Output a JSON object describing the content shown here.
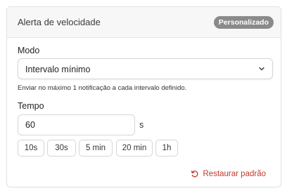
{
  "header": {
    "title": "Alerta de velocidade",
    "badge": "Personalizado"
  },
  "mode": {
    "label": "Modo",
    "selected": "Intervalo mínimo",
    "help_text": "Enviar no máximo 1 notificação a cada intervalo definido."
  },
  "time": {
    "label": "Tempo",
    "value": "60",
    "unit": "s",
    "presets": [
      "10s",
      "30s",
      "5 min",
      "20 min",
      "1h"
    ]
  },
  "actions": {
    "restore_label": "Restaurar padrão"
  },
  "colors": {
    "badge_bg": "#8a8a8a",
    "accent_danger": "#c0392b",
    "border": "#d6d6d6"
  },
  "icons": {
    "select_chevron": "chevron-down-icon",
    "restore": "rotate-ccw-icon"
  }
}
